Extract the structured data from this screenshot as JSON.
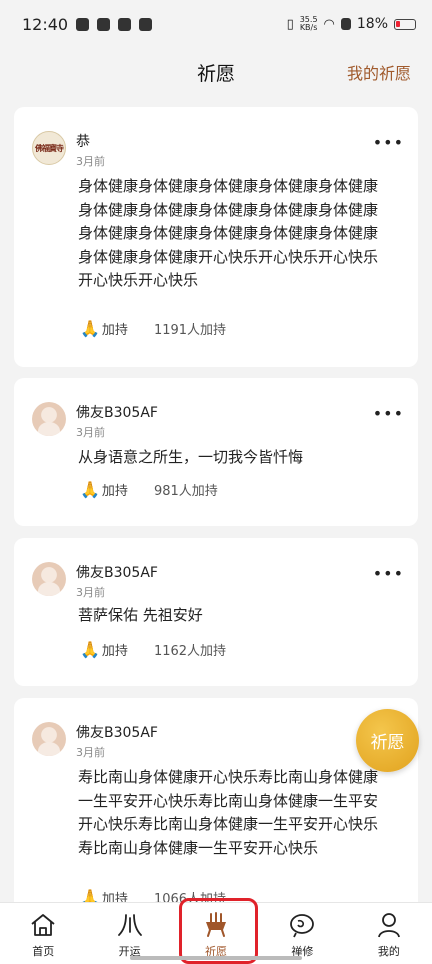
{
  "status_bar": {
    "time": "12:40",
    "net_speed_value": "35.5",
    "net_speed_unit": "KB/s",
    "battery": "18%"
  },
  "header": {
    "title": "祈愿",
    "my_wishes": "我的祈愿"
  },
  "posts": [
    {
      "username": "恭",
      "time": "3月前",
      "avatar_text": "佛福寶寺",
      "content": "身体健康身体健康身体健康身体健康身体健康身体健康身体健康身体健康身体健康身体健康身体健康身体健康身体健康身体健康身体健康身体健康身体健康开心快乐开心快乐开心快乐开心快乐开心快乐",
      "bless_label": "加持",
      "bless_count": "1191人加持"
    },
    {
      "username": "佛友B305AF",
      "time": "3月前",
      "content": "从身语意之所生，一切我今皆忏悔",
      "bless_label": "加持",
      "bless_count": "981人加持"
    },
    {
      "username": "佛友B305AF",
      "time": "3月前",
      "content": "菩萨保佑 先祖安好",
      "bless_label": "加持",
      "bless_count": "1162人加持"
    },
    {
      "username": "佛友B305AF",
      "time": "3月前",
      "content": "寿比南山身体健康开心快乐寿比南山身体健康一生平安开心快乐寿比南山身体健康一生平安开心快乐寿比南山身体健康一生平安开心快乐寿比南山身体健康一生平安开心快乐",
      "bless_label": "加持",
      "bless_count": "1066人加持"
    }
  ],
  "fab_label": "祈愿",
  "nav": [
    {
      "label": "首页",
      "icon": "home-icon"
    },
    {
      "label": "开运",
      "icon": "fortune-icon"
    },
    {
      "label": "祈愿",
      "icon": "incense-icon"
    },
    {
      "label": "禅修",
      "icon": "meditation-icon"
    },
    {
      "label": "我的",
      "icon": "profile-icon"
    }
  ],
  "colors": {
    "accent": "#a05a2c",
    "fab": "#e8ad2a",
    "highlight": "#e0222a"
  }
}
